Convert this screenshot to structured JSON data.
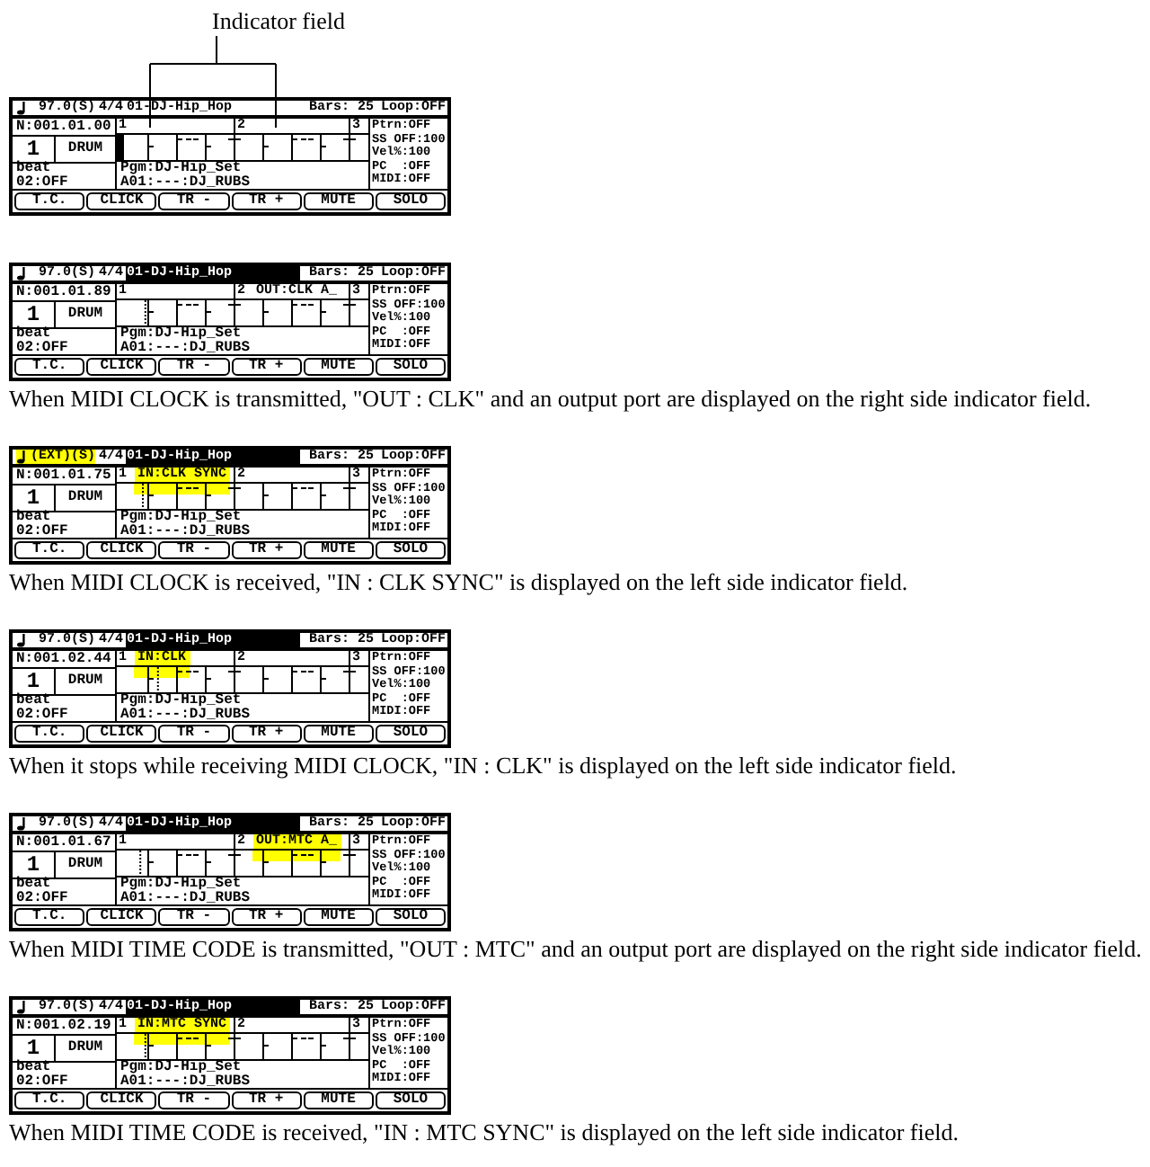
{
  "callout": {
    "label": "Indicator field"
  },
  "screens": [
    {
      "tempo": {
        "text": "97.0(S)",
        "highlighted": false
      },
      "time_signature": "4/4",
      "song": {
        "name": "01-DJ-Hip_Hop",
        "selected": false
      },
      "bars": "Bars: 25",
      "loop": "Loop:OFF",
      "position": "N:001.01.00",
      "track_number": "1",
      "track_name": "DRUM",
      "beat": "beat",
      "beat_value": "02:OFF",
      "bar_markers": [
        "1",
        "2",
        "3"
      ],
      "cursor": {
        "kind": "block",
        "level": 0
      },
      "program": "Pgm:DJ-Hip_Set",
      "sample": "A01:---:DJ_RUBS",
      "settings": [
        "Ptrn:OFF",
        "SS OFF:100",
        "Vel%:100",
        "PC  :OFF",
        "MIDI:OFF"
      ],
      "function_keys": [
        "T.C.",
        "CLICK",
        "TR -",
        "TR +",
        "MUTE",
        "SOLO"
      ]
    },
    {
      "tempo": {
        "text": "97.0(S)",
        "highlighted": false
      },
      "time_signature": "4/4",
      "song": {
        "name": "01-DJ-Hip_Hop",
        "selected": true
      },
      "bars": "Bars: 25",
      "loop": "Loop:OFF",
      "position": "N:001.01.89",
      "track_number": "1",
      "track_name": "DRUM",
      "beat": "beat",
      "beat_value": "02:OFF",
      "bar_markers": [
        "1",
        "2",
        "3"
      ],
      "indicator_right": {
        "text": "OUT:CLK A_",
        "highlighted": false
      },
      "cursor": {
        "kind": "dotted",
        "level": 0.11
      },
      "program": "Pgm:DJ-Hip_Set",
      "sample": "A01:---:DJ_RUBS",
      "settings": [
        "Ptrn:OFF",
        "SS OFF:100",
        "Vel%:100",
        "PC  :OFF",
        "MIDI:OFF"
      ],
      "function_keys": [
        "T.C.",
        "CLICK",
        "TR -",
        "TR +",
        "MUTE",
        "SOLO"
      ],
      "caption": "When MIDI CLOCK is transmitted, \"OUT : CLK\" and an output port are displayed on the right side indicator field."
    },
    {
      "tempo": {
        "text": "(EXT)(S)",
        "highlighted": true
      },
      "time_signature": "4/4",
      "song": {
        "name": "01-DJ-Hip_Hop",
        "selected": true
      },
      "bars": "Bars: 25",
      "loop": "Loop:OFF",
      "position": "N:001.01.75",
      "track_number": "1",
      "track_name": "DRUM",
      "beat": "beat",
      "beat_value": "02:OFF",
      "bar_markers": [
        "1",
        "2",
        "3"
      ],
      "indicator_left": {
        "text": "IN:CLK SYNC",
        "highlighted": true
      },
      "cursor": {
        "kind": "dotted",
        "level": 0.1
      },
      "program": "Pgm:DJ-Hip_Set",
      "sample": "A01:---:DJ_RUBS",
      "settings": [
        "Ptrn:OFF",
        "SS OFF:100",
        "Vel%:100",
        "PC  :OFF",
        "MIDI:OFF"
      ],
      "function_keys": [
        "T.C.",
        "CLICK",
        "TR -",
        "TR +",
        "MUTE",
        "SOLO"
      ],
      "caption": "When MIDI CLOCK is received, \"IN : CLK SYNC\" is displayed on the left side indicator field."
    },
    {
      "tempo": {
        "text": "97.0(S)",
        "highlighted": false
      },
      "time_signature": "4/4",
      "song": {
        "name": "01-DJ-Hip_Hop",
        "selected": true
      },
      "bars": "Bars: 25",
      "loop": "Loop:OFF",
      "position": "N:001.02.44",
      "track_number": "1",
      "track_name": "DRUM",
      "beat": "beat",
      "beat_value": "02:OFF",
      "bar_markers": [
        "1",
        "2",
        "3"
      ],
      "indicator_left": {
        "text": "IN:CLK",
        "highlighted": true
      },
      "cursor": {
        "kind": "dotted",
        "level": 0.16
      },
      "program": "Pgm:DJ-Hip_Set",
      "sample": "A01:---:DJ_RUBS",
      "settings": [
        "Ptrn:OFF",
        "SS OFF:100",
        "Vel%:100",
        "PC  :OFF",
        "MIDI:OFF"
      ],
      "function_keys": [
        "T.C.",
        "CLICK",
        "TR -",
        "TR +",
        "MUTE",
        "SOLO"
      ],
      "caption": "When it stops while receiving MIDI CLOCK, \"IN : CLK\" is displayed on the left side indicator field."
    },
    {
      "tempo": {
        "text": "97.0(S)",
        "highlighted": false
      },
      "time_signature": "4/4",
      "song": {
        "name": "01-DJ-Hip_Hop",
        "selected": true
      },
      "bars": "Bars: 25",
      "loop": "Loop:OFF",
      "position": "N:001.01.67",
      "track_number": "1",
      "track_name": "DRUM",
      "beat": "beat",
      "beat_value": "02:OFF",
      "bar_markers": [
        "1",
        "2",
        "3"
      ],
      "indicator_right": {
        "text": "OUT:MTC A_",
        "highlighted": true
      },
      "cursor": {
        "kind": "dotted",
        "level": 0.09
      },
      "program": "Pgm:DJ-Hip_Set",
      "sample": "A01:---:DJ_RUBS",
      "settings": [
        "Ptrn:OFF",
        "SS OFF:100",
        "Vel%:100",
        "PC  :OFF",
        "MIDI:OFF"
      ],
      "function_keys": [
        "T.C.",
        "CLICK",
        "TR -",
        "TR +",
        "MUTE",
        "SOLO"
      ],
      "caption": "When MIDI TIME CODE is transmitted, \"OUT : MTC\" and an output port are displayed on the right side indicator field."
    },
    {
      "tempo": {
        "text": "97.0(S)",
        "highlighted": false
      },
      "time_signature": "4/4",
      "song": {
        "name": "01-DJ-Hip_Hop",
        "selected": true
      },
      "bars": "Bars: 25",
      "loop": "Loop:OFF",
      "position": "N:001.02.19",
      "track_number": "1",
      "track_name": "DRUM",
      "beat": "beat",
      "beat_value": "02:OFF",
      "bar_markers": [
        "1",
        "2",
        "3"
      ],
      "indicator_left": {
        "text": "IN:MTC SYNC",
        "highlighted": true
      },
      "cursor": {
        "kind": "dotted",
        "level": 0.11
      },
      "program": "Pgm:DJ-Hip_Set",
      "sample": "A01:---:DJ_RUBS",
      "settings": [
        "Ptrn:OFF",
        "SS OFF:100",
        "Vel%:100",
        "PC  :OFF",
        "MIDI:OFF"
      ],
      "function_keys": [
        "T.C.",
        "CLICK",
        "TR -",
        "TR +",
        "MUTE",
        "SOLO"
      ],
      "caption": "When MIDI TIME CODE is received, \"IN : MTC SYNC\" is displayed on the left side indicator field."
    }
  ]
}
